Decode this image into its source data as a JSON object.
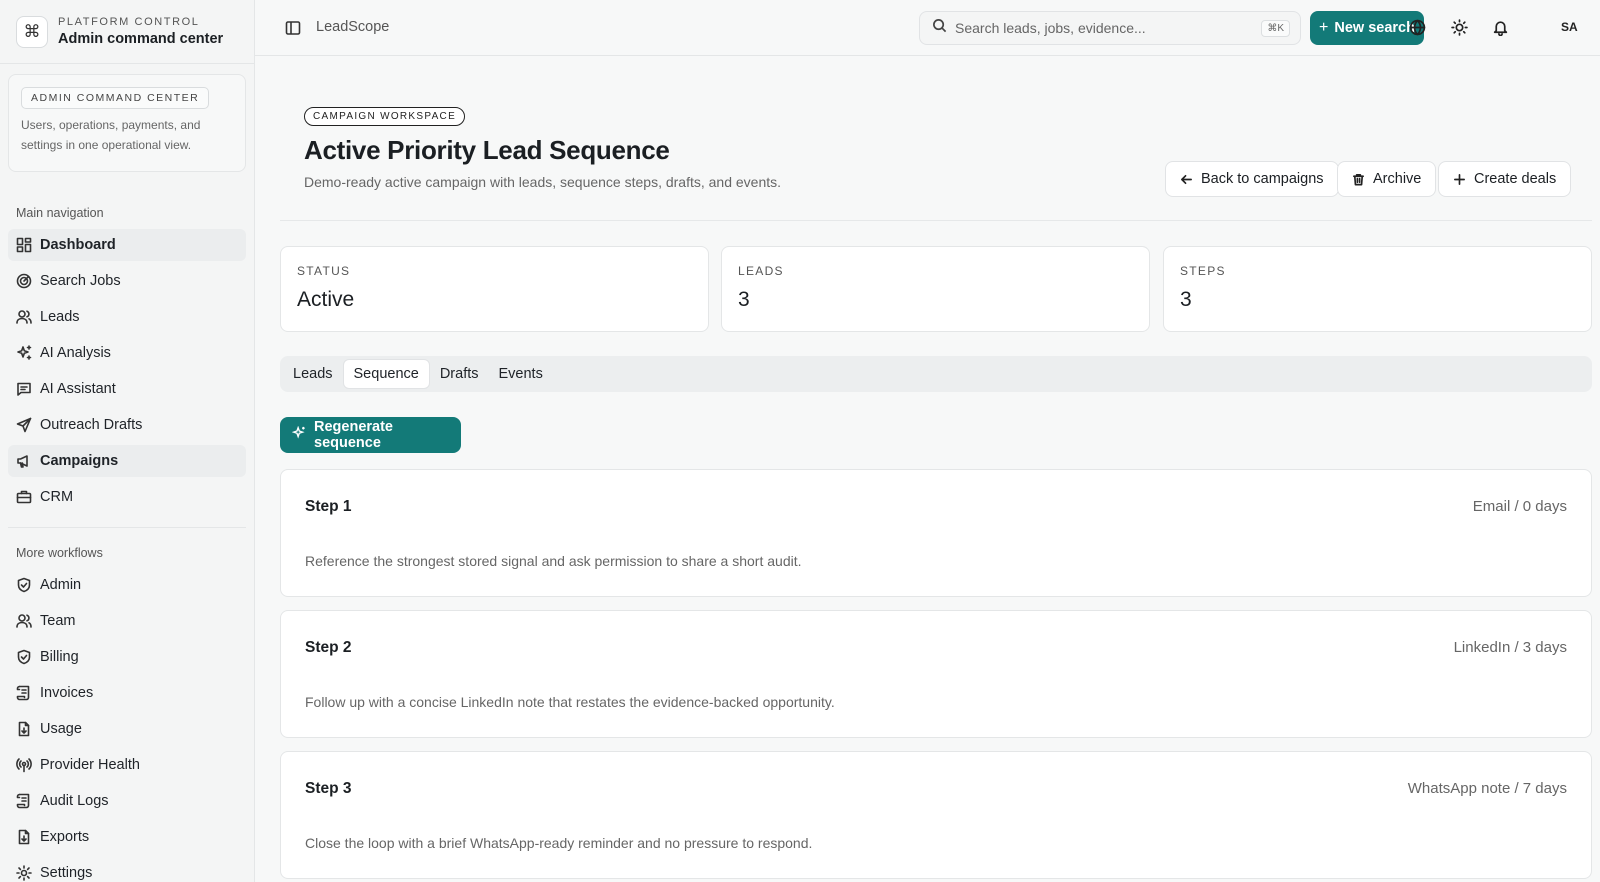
{
  "sidebar": {
    "brand_kicker": "PLATFORM CONTROL",
    "brand_title": "Admin command center",
    "brand_icon": "command-icon",
    "card_badge": "ADMIN COMMAND CENTER",
    "card_desc": "Users, operations, payments, and settings in one operational view.",
    "main_heading": "Main navigation",
    "main_items": [
      {
        "label": "Dashboard",
        "icon": "dashboard-icon"
      },
      {
        "label": "Search Jobs",
        "icon": "radar-icon"
      },
      {
        "label": "Leads",
        "icon": "users-icon"
      },
      {
        "label": "AI Analysis",
        "icon": "sparkles-icon"
      },
      {
        "label": "AI Assistant",
        "icon": "message-icon"
      },
      {
        "label": "Outreach Drafts",
        "icon": "send-icon"
      },
      {
        "label": "Campaigns",
        "icon": "megaphone-icon"
      },
      {
        "label": "CRM",
        "icon": "briefcase-icon"
      }
    ],
    "more_heading": "More workflows",
    "more_items": [
      {
        "label": "Admin",
        "icon": "shield-check-icon"
      },
      {
        "label": "Team",
        "icon": "users-icon"
      },
      {
        "label": "Billing",
        "icon": "shield-icon"
      },
      {
        "label": "Invoices",
        "icon": "scroll-icon"
      },
      {
        "label": "Usage",
        "icon": "file-down-icon"
      },
      {
        "label": "Provider Health",
        "icon": "radio-icon"
      },
      {
        "label": "Audit Logs",
        "icon": "scroll-icon"
      },
      {
        "label": "Exports",
        "icon": "file-down-icon"
      },
      {
        "label": "Settings",
        "icon": "gear-icon"
      }
    ],
    "active_item": "Campaigns"
  },
  "topbar": {
    "app_name": "LeadScope",
    "search_placeholder": "Search leads, jobs, evidence...",
    "search_shortcut": "⌘K",
    "new_search_label": "New search",
    "avatar_initials": "SA"
  },
  "page": {
    "kicker": "CAMPAIGN WORKSPACE",
    "title": "Active Priority Lead Sequence",
    "subtitle": "Demo-ready active campaign with leads, sequence steps, drafts, and events.",
    "back_label": "Back to campaigns",
    "archive_label": "Archive",
    "create_deals_label": "Create deals"
  },
  "stats": [
    {
      "label": "STATUS",
      "value": "Active"
    },
    {
      "label": "LEADS",
      "value": "3"
    },
    {
      "label": "STEPS",
      "value": "3"
    }
  ],
  "tabs": [
    "Leads",
    "Sequence",
    "Drafts",
    "Events"
  ],
  "active_tab": "Sequence",
  "regenerate_label": "Regenerate sequence",
  "steps": [
    {
      "title": "Step 1",
      "meta": "Email / 0 days",
      "body": "Reference the strongest stored signal and ask permission to share a short audit."
    },
    {
      "title": "Step 2",
      "meta": "LinkedIn / 3 days",
      "body": "Follow up with a concise LinkedIn note that restates the evidence-backed opportunity."
    },
    {
      "title": "Step 3",
      "meta": "WhatsApp note / 7 days",
      "body": "Close the loop with a brief WhatsApp-ready reminder and no pressure to respond."
    }
  ],
  "colors": {
    "accent": "#137a78",
    "background": "#f7f8f8",
    "sidebar": "#f4f5f5"
  }
}
